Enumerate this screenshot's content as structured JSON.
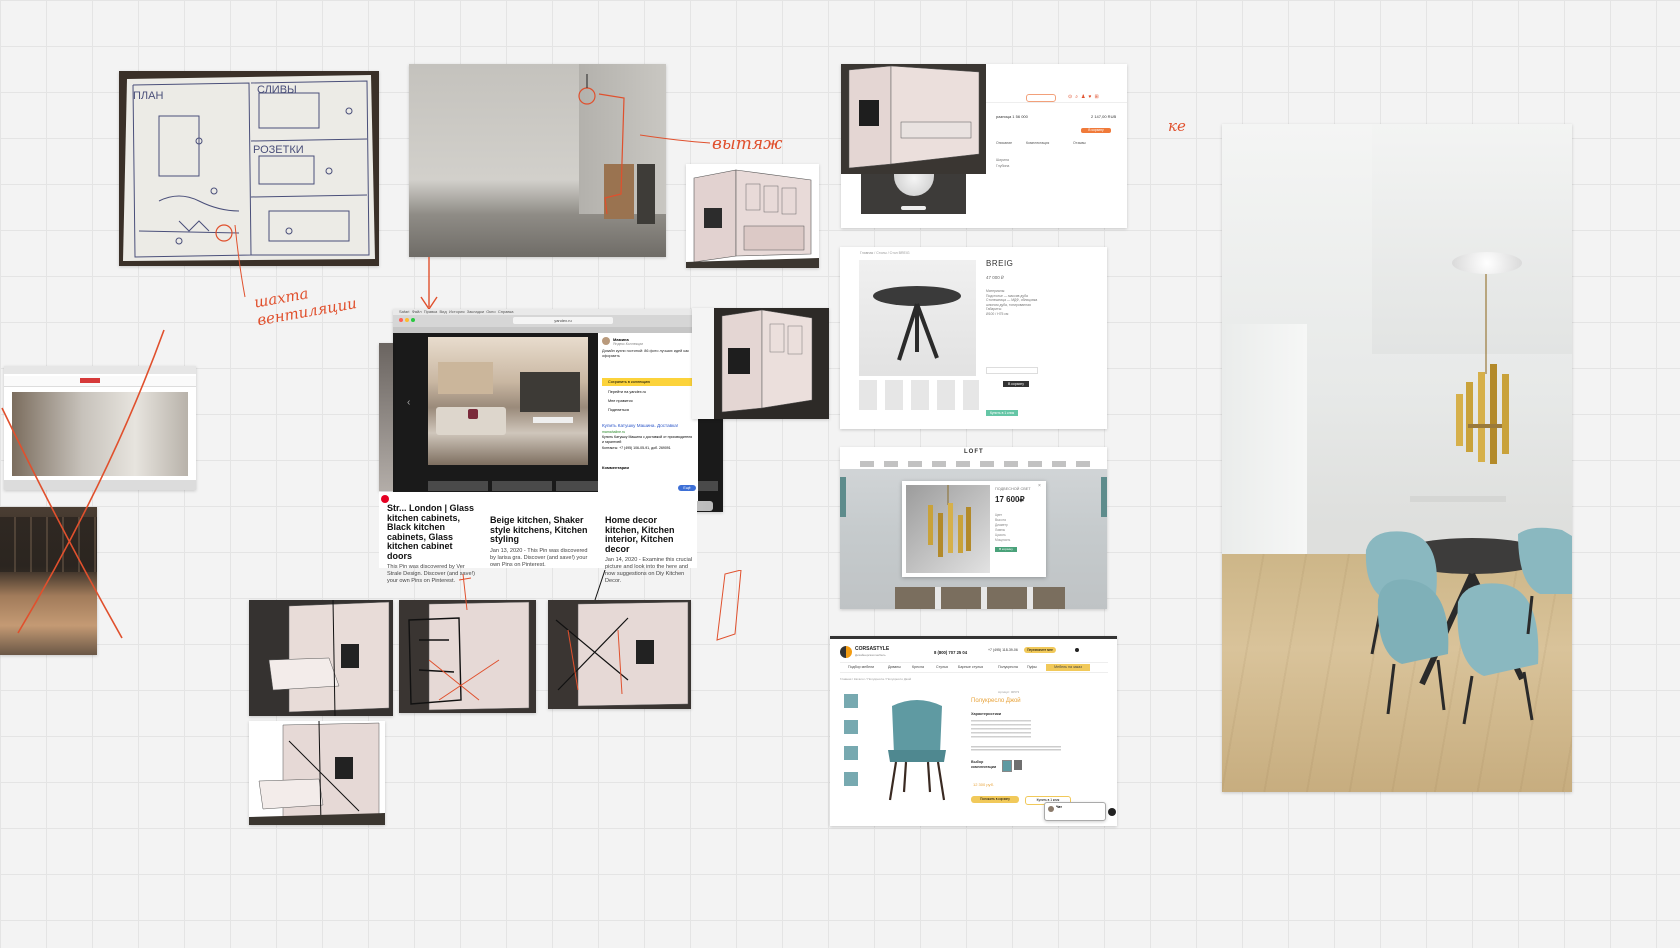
{
  "colors": {
    "board_bg": "#f3f3f3",
    "grid": "#e4e4e4",
    "annotation": "#e0502d",
    "teal_chair": "#8ab8c0",
    "gold_lamp": "#c9a23a"
  },
  "handwriting": {
    "vytyazhka": "вытяж",
    "shakhta": "шахта вентиляции",
    "top_right": "ке"
  },
  "sketch": {
    "plan": "ПЛАН",
    "slivy": "СЛИВЫ",
    "rozetki": "РОЗЕТКИ"
  },
  "browser": {
    "menu": [
      "Safari",
      "Файл",
      "Правка",
      "Вид",
      "История",
      "Закладки",
      "Окно",
      "Справка"
    ],
    "url": "yandex.ru",
    "clock": "Ср 11:16",
    "side_user": "Мамина",
    "side_source": "Яндекс.Коллекции",
    "side_text": "Дизайн кухни гостиной: 86 фото лучших идей как оформить",
    "save_button": "Сохранить в коллекцию",
    "goto_site": "Перейти на yandex.ru",
    "like": "Мне нравится",
    "share": "Поделиться",
    "ad_title": "Купить Катушку Машина. Доставка!",
    "ad_site": "mamahaline.ru",
    "ad_text": "Купить Катушку Машина с доставкой от производителя и гарантией",
    "ad_phone": "Контакты: +7 (495) 106-05-91, доб. 269091",
    "comments": "Комментарии",
    "more": "Ещё"
  },
  "pins": [
    {
      "title": "Str... London | Glass kitchen cabinets, Black kitchen cabinets, Glass kitchen cabinet doors",
      "desc": "This Pin was discovered by Ver Strale Design. Discover (and save!) your own Pins on Pinterest."
    },
    {
      "title": "Beige kitchen, Shaker style kitchens, Kitchen styling",
      "desc": "Jan 13, 2020 - This Pin was discovered by larisa gra. Discover (and save!) your own Pins on Pinterest."
    },
    {
      "title": "Home decor kitchen, Kitchen interior, Kitchen decor",
      "desc": "Jan 14, 2020 - Examine this crucial picture and look into the here and now suggestions on Diy Kitchen Decor."
    }
  ],
  "shop_top": {
    "price_label": "разница 1 56 000",
    "price": "2 147,00 RUB",
    "buy": "В корзину",
    "tabs": [
      "Описание",
      "Комплектация",
      "Отзывы"
    ],
    "row1": "Ширина",
    "row2": "Глубина"
  },
  "breig": {
    "title": "BREIG",
    "price": "47 000 ₽",
    "breadcrumb": "Главная / Столы / Стол BREIG",
    "cart_button": "В корзину",
    "quick_button": "Купить в 1 клик",
    "desc_lines": [
      "Материалы:",
      "Подстолье — массив дуба",
      "Столешница — МДФ, облицовка",
      "шпоном дуба, тонированная",
      "",
      "Габариты:",
      "Ø100 / H75 см"
    ]
  },
  "loft": {
    "logo": "LOFT",
    "title": "ПОДВЕСНОЙ СВЕТ",
    "price": "17 600₽",
    "button": "В корзину",
    "specs": [
      "Цвет",
      "Высота",
      "Диаметр",
      "Лампы",
      "Цоколь",
      "Мощность"
    ]
  },
  "corsa": {
    "logo": "CORSASTYLE",
    "tagline": "Дизайнерская мебель",
    "phone": "8 (800) 707 25 04",
    "phone2": "+7 (495) 118-39-06",
    "callback": "Перезвоните мне",
    "nav": [
      "Подбор мебели",
      "Диваны",
      "Кресла",
      "Стулья",
      "Барные стулья",
      "Полукресла",
      "Пуфы",
      "Мебель на заказ"
    ],
    "breadcrumb": "Главная / Каталог / Полукресла / Полукресло Джой",
    "product_title": "Полукресло Джой",
    "char_title": "Характеристики",
    "config": "Выбор комплектации",
    "price": "12 300 руб.",
    "cart": "Положить в корзину",
    "oneclick": "Купить в 1 клик",
    "chat": "Чат",
    "sku": "Артикул: 00573"
  }
}
